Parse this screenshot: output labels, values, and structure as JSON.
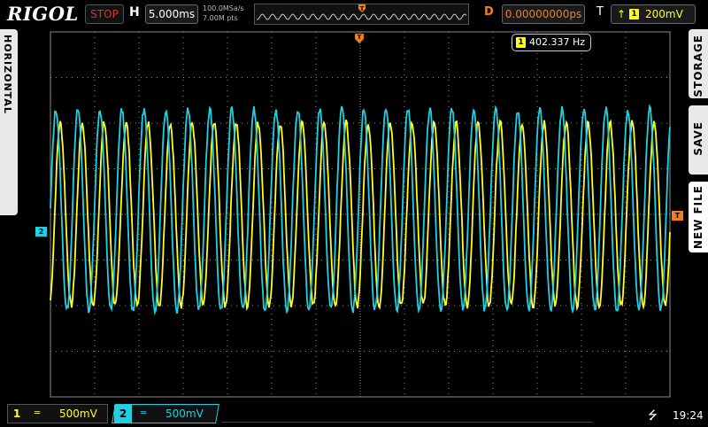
{
  "brand": "RIGOL",
  "run_state": {
    "label": "STOP",
    "color": "#e03030"
  },
  "horizontal": {
    "label": "H",
    "timebase": "5.000ms"
  },
  "acquisition": {
    "sample_rate": "100.0MSa/s",
    "memory_depth": "7.00M pts"
  },
  "delay": {
    "label": "D",
    "value": "0.00000000ps"
  },
  "trigger": {
    "label": "T",
    "edge_icon": "rising-edge-icon",
    "channel": "1",
    "level": "200mV"
  },
  "side_tabs": {
    "left": "HORIZONTAL",
    "right": [
      "STORAGE",
      "SAVE",
      "NEW FILE"
    ]
  },
  "measurement": {
    "channel": "1",
    "frequency": "402.337 Hz"
  },
  "markers": {
    "ch2_ground": "2",
    "trigger_level": "T",
    "trigger_position": "T"
  },
  "channels": [
    {
      "number": "1",
      "coupling_icon": "dc-coupling-icon",
      "scale": "500mV",
      "color": "#ffff20"
    },
    {
      "number": "2",
      "coupling_icon": "dc-coupling-icon",
      "scale": "500mV",
      "color": "#20d0e0"
    }
  ],
  "status": {
    "usb_icon": "usb-icon",
    "time": "19:24"
  },
  "colors": {
    "ch1": "#ffff20",
    "ch2": "#20d0e0",
    "trigger": "#f08020",
    "grid": "#8a8a8a"
  },
  "waveforms": {
    "ch1": {
      "frequency_hz": 402.337,
      "amplitude_v": 1.0,
      "phase_deg": 70,
      "offset_v": 0.0
    },
    "ch2": {
      "frequency_hz": 402.337,
      "amplitude_v": 1.1,
      "phase_deg": 0,
      "offset_v": 0.05
    }
  }
}
